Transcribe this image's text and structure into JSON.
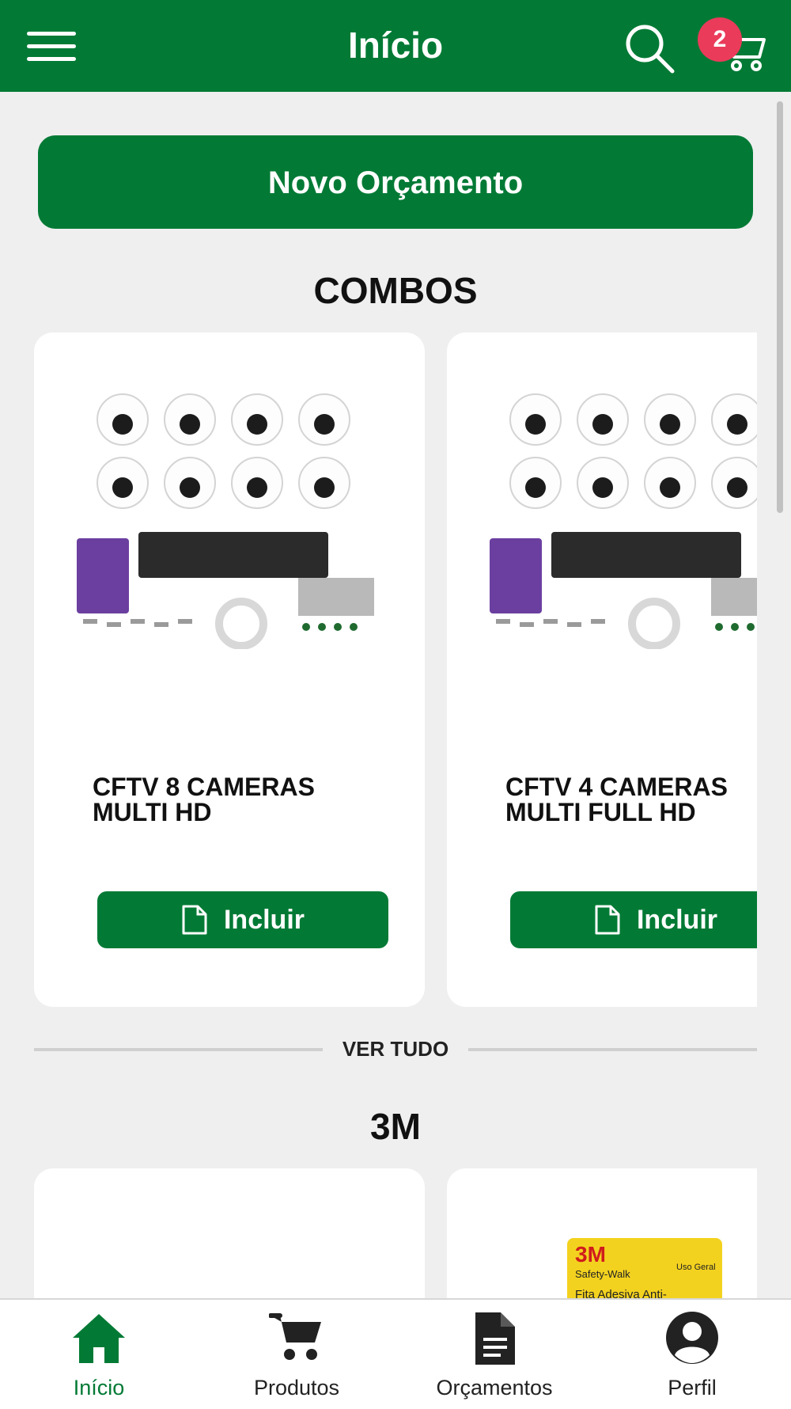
{
  "header": {
    "title": "Início",
    "cart_count": "2"
  },
  "actions": {
    "new_quote_label": "Novo Orçamento"
  },
  "sections": [
    {
      "title": "COMBOS",
      "see_all_label": "VER TUDO",
      "products": [
        {
          "name": "CFTV 8 CAMERAS MULTI HD",
          "button_label": "Incluir"
        },
        {
          "name": "CFTV 4 CAMERAS MULTI FULL HD",
          "button_label": "Incluir"
        }
      ]
    },
    {
      "title": "3M"
    }
  ],
  "third_party_logo": {
    "brand": "3M",
    "line1": "Safety-Walk",
    "line2": "Uso Geral",
    "line3": "Fita Adesiva Anti-"
  },
  "bottom_nav": [
    {
      "label": "Início",
      "icon": "home-icon",
      "active": true
    },
    {
      "label": "Produtos",
      "icon": "cart-icon",
      "active": false
    },
    {
      "label": "Orçamentos",
      "icon": "document-icon",
      "active": false
    },
    {
      "label": "Perfil",
      "icon": "user-icon",
      "active": false
    }
  ],
  "colors": {
    "primary": "#027a35",
    "badge": "#ea3b5b",
    "background": "#efefef"
  }
}
